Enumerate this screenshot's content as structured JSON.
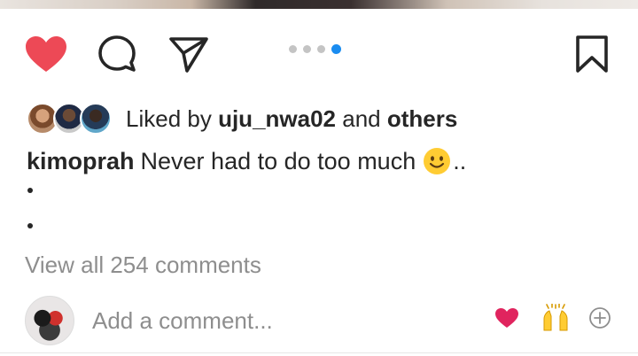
{
  "post": {
    "carousel": {
      "total": 4,
      "active_index": 3
    },
    "likes": {
      "prefix": "Liked by",
      "user": "uju_nwa02",
      "joiner": "and",
      "others": "others"
    },
    "caption": {
      "username": "kimoprah",
      "text": "Never had to do too much",
      "emoji": "slightly-smiling-face",
      "tail": ".."
    },
    "view_comments": "View all 254 comments"
  },
  "comment_box": {
    "placeholder": "Add a comment...",
    "quick_reactions": [
      "heart",
      "raised-hands",
      "add"
    ]
  },
  "colors": {
    "like_red": "#ed4956",
    "carousel_active": "#1a8cf0",
    "reaction_pink": "#e0245e",
    "muted": "#8e8e8e"
  }
}
